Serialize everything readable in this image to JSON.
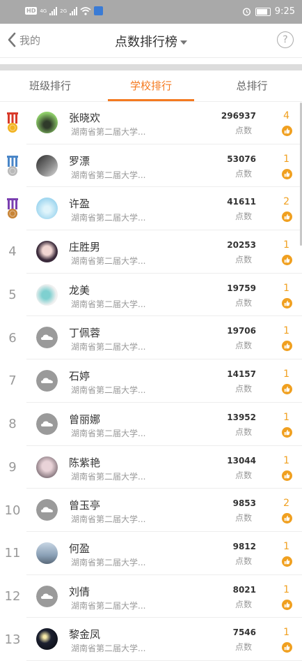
{
  "status_bar": {
    "left_badge": "HD",
    "network1": "4G",
    "network2": "2G",
    "time": "9:25"
  },
  "nav": {
    "back_label": "我的",
    "title": "点数排行榜",
    "help_label": "?"
  },
  "tabs": [
    {
      "label": "班级排行",
      "active": false
    },
    {
      "label": "学校排行",
      "active": true
    },
    {
      "label": "总排行",
      "active": false
    }
  ],
  "colors": {
    "accent": "#f47a20",
    "like": "#f0a020"
  },
  "points_unit": "点数",
  "rows": [
    {
      "rank": "",
      "medal": "gold",
      "name": "张晓欢",
      "school": "湖南省第二届大学...",
      "points": "296937",
      "likes": "4",
      "avatar": "photo-green"
    },
    {
      "rank": "",
      "medal": "silver",
      "name": "罗漂",
      "school": "湖南省第二届大学...",
      "points": "53076",
      "likes": "1",
      "avatar": "photo-dark"
    },
    {
      "rank": "",
      "medal": "bronze",
      "name": "许盈",
      "school": "湖南省第二届大学...",
      "points": "41611",
      "likes": "2",
      "avatar": "photo-blue"
    },
    {
      "rank": "4",
      "medal": "",
      "name": "庄胜男",
      "school": "湖南省第二届大学...",
      "points": "20253",
      "likes": "1",
      "avatar": "photo-girl"
    },
    {
      "rank": "5",
      "medal": "",
      "name": "龙美",
      "school": "湖南省第二届大学...",
      "points": "19759",
      "likes": "1",
      "avatar": "photo-teal"
    },
    {
      "rank": "6",
      "medal": "",
      "name": "丁佩蓉",
      "school": "湖南省第二届大学...",
      "points": "19706",
      "likes": "1",
      "avatar": "default-cloud"
    },
    {
      "rank": "7",
      "medal": "",
      "name": "石婷",
      "school": "湖南省第二届大学...",
      "points": "14157",
      "likes": "1",
      "avatar": "default-cloud"
    },
    {
      "rank": "8",
      "medal": "",
      "name": "曾丽娜",
      "school": "湖南省第二届大学...",
      "points": "13952",
      "likes": "1",
      "avatar": "default-cloud"
    },
    {
      "rank": "9",
      "medal": "",
      "name": "陈紫艳",
      "school": "湖南省第二届大学...",
      "points": "13044",
      "likes": "1",
      "avatar": "photo-pink"
    },
    {
      "rank": "10",
      "medal": "",
      "name": "曾玉亭",
      "school": "湖南省第二届大学...",
      "points": "9853",
      "likes": "2",
      "avatar": "default-cloud"
    },
    {
      "rank": "11",
      "medal": "",
      "name": "何盈",
      "school": "湖南省第二届大学...",
      "points": "9812",
      "likes": "1",
      "avatar": "photo-sky"
    },
    {
      "rank": "12",
      "medal": "",
      "name": "刘倩",
      "school": "湖南省第二届大学...",
      "points": "8021",
      "likes": "1",
      "avatar": "default-cloud"
    },
    {
      "rank": "13",
      "medal": "",
      "name": "黎金凤",
      "school": "湖南省第二届大学...",
      "points": "7546",
      "likes": "1",
      "avatar": "photo-night"
    }
  ]
}
